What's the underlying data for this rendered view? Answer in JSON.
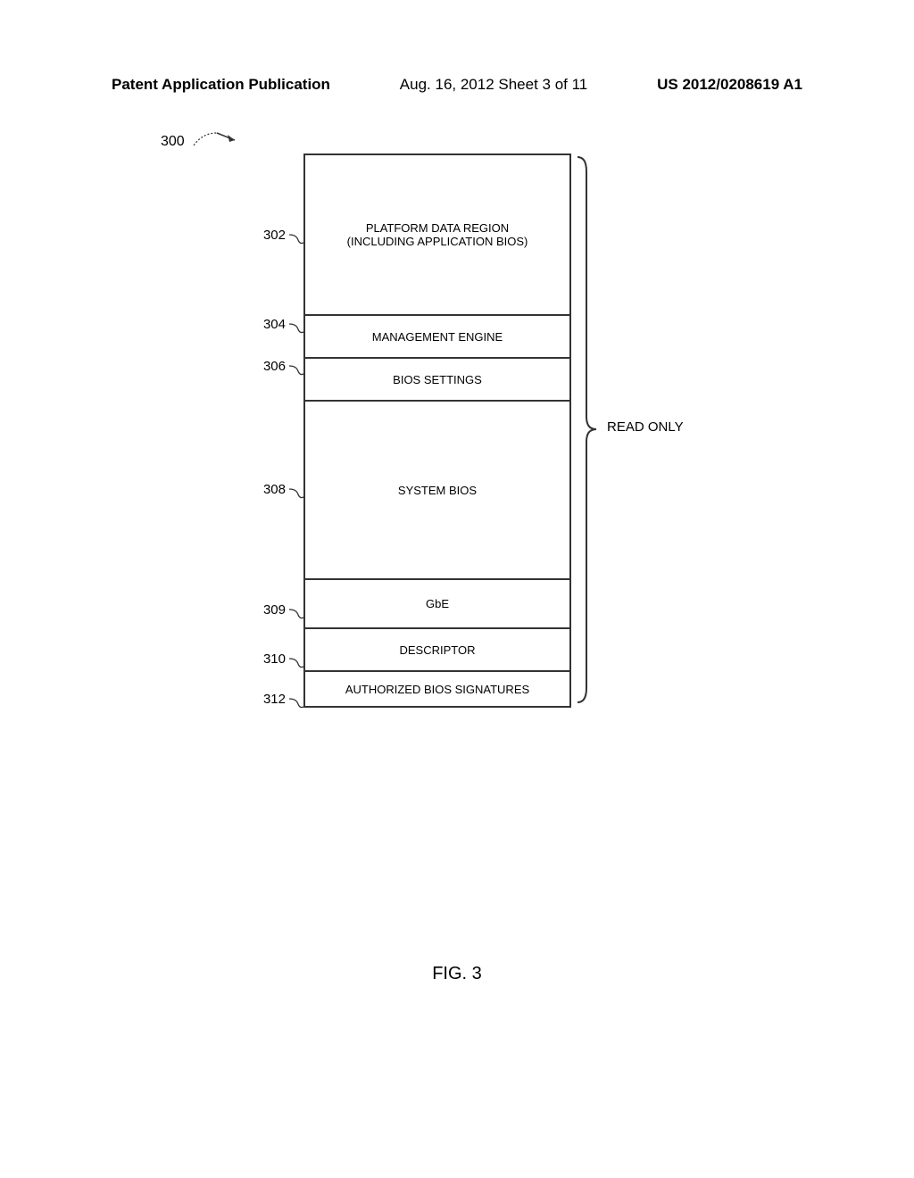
{
  "header": {
    "left": "Patent Application Publication",
    "center": "Aug. 16, 2012  Sheet 3 of 11",
    "right": "US 2012/0208619 A1"
  },
  "diagram": {
    "ref_overall": "300",
    "rows": [
      {
        "ref": "302",
        "label": "PLATFORM DATA REGION\n(INCLUDING APPLICATION BIOS)",
        "class": "row-302"
      },
      {
        "ref": "304",
        "label": "MANAGEMENT ENGINE",
        "class": "row-304"
      },
      {
        "ref": "306",
        "label": "BIOS SETTINGS",
        "class": "row-306"
      },
      {
        "ref": "308",
        "label": "SYSTEM BIOS",
        "class": "row-308"
      },
      {
        "ref": "309",
        "label": "GbE",
        "class": "row-309"
      },
      {
        "ref": "310",
        "label": "DESCRIPTOR",
        "class": "row-310"
      },
      {
        "ref": "312",
        "label": "AUTHORIZED BIOS SIGNATURES",
        "class": "row-312"
      }
    ],
    "bracket_label": "READ ONLY"
  },
  "figure_label": "FIG. 3",
  "ref_positions": {
    "302": 115,
    "304": 215,
    "306": 262,
    "308": 400,
    "309": 535,
    "310": 590,
    "312": 635
  }
}
